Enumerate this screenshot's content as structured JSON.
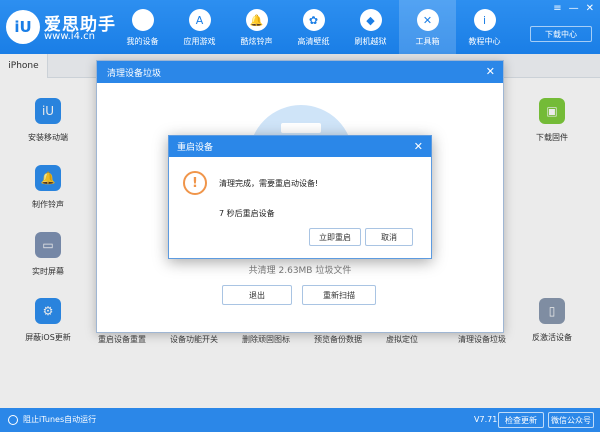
{
  "header": {
    "logo_text": "iU",
    "brand_title": "爱思助手",
    "brand_url": "www.i4.cn",
    "nav": [
      {
        "label": "我的设备",
        "icon": "apple-icon"
      },
      {
        "label": "应用游戏",
        "icon": "app-store-icon"
      },
      {
        "label": "酷炫铃声",
        "icon": "bell-icon"
      },
      {
        "label": "高清壁纸",
        "icon": "wallpaper-icon"
      },
      {
        "label": "刷机越狱",
        "icon": "dropbox-icon"
      },
      {
        "label": "工具箱",
        "icon": "tools-icon"
      },
      {
        "label": "教程中心",
        "icon": "info-icon"
      }
    ],
    "active_nav": "工具箱",
    "window_controls": [
      "≡",
      "—",
      "✕"
    ],
    "download_center": "下载中心"
  },
  "tabstrip": {
    "tab": "iPhone"
  },
  "tools": {
    "left": [
      "安装移动端",
      "制作铃声",
      "实时屏幕",
      "屏蔽iOS更新"
    ],
    "right": [
      "下载固件",
      "反激活设备"
    ],
    "bottom_partial": [
      "重启设备重置",
      "设备功能开关",
      "删除顽固图标",
      "预览备份数据",
      "虚拟定位",
      "清理设备垃圾"
    ]
  },
  "outer_dialog": {
    "title": "清理设备垃圾",
    "summary": "共清理 2.63MB 垃圾文件",
    "buttons": {
      "exit": "退出",
      "rescan": "重新扫描"
    }
  },
  "inner_dialog": {
    "title": "重启设备",
    "message": "清理完成，需要重启动设备!",
    "countdown": "7 秒后重启设备",
    "buttons": {
      "restart_now": "立即重启",
      "cancel": "取消"
    }
  },
  "footer": {
    "itunes_block": "阻止iTunes自动运行",
    "version": "V7.71",
    "check_update": "检查更新",
    "wechat": "微信公众号"
  },
  "colors": {
    "brand_blue": "#2b87e8",
    "warning_orange": "#f0954a"
  }
}
